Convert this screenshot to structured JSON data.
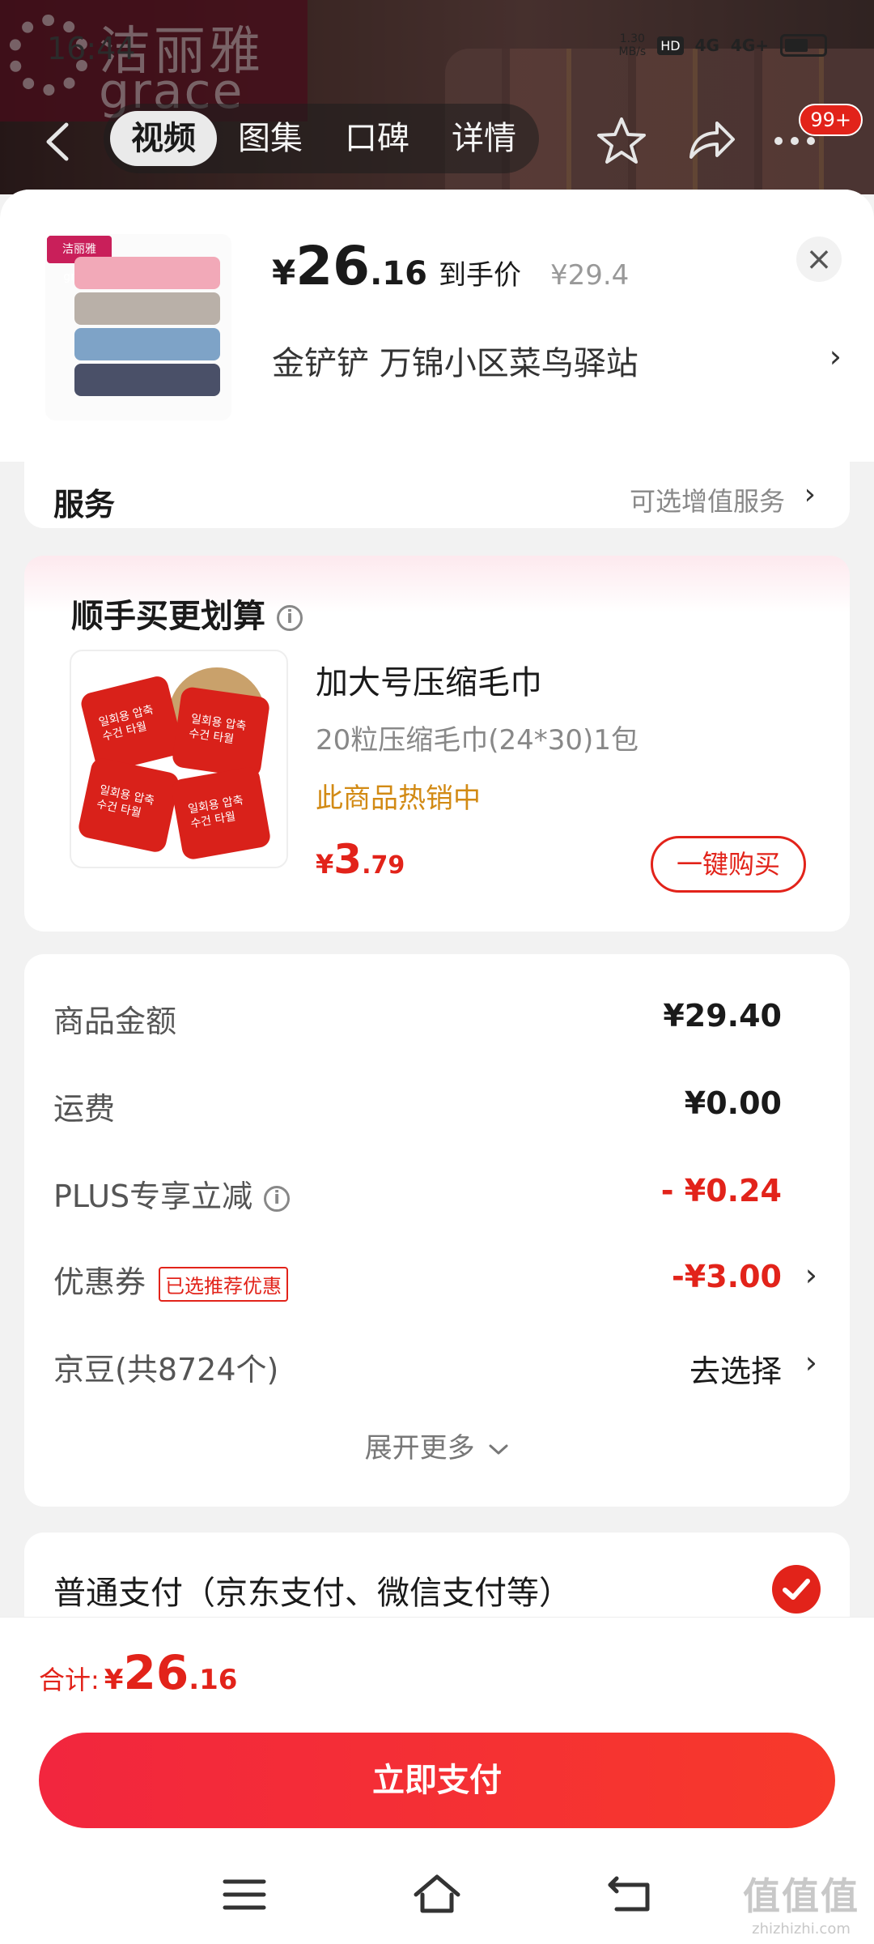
{
  "status_bar": {
    "time": "16:44",
    "net_speed": "1.30\nMB/s",
    "hd": "HD",
    "sim1": "4G",
    "sim2": "4G+"
  },
  "background_page": {
    "brand_cn": "洁丽雅",
    "brand_en": "grace",
    "tabs": [
      {
        "label": "视频",
        "active": true
      },
      {
        "label": "图集",
        "active": false
      },
      {
        "label": "口碑",
        "active": false
      },
      {
        "label": "详情",
        "active": false
      }
    ],
    "cart_badge": "99+"
  },
  "sheet": {
    "product": {
      "thumb_brand": "洁丽雅grace",
      "price_symbol": "¥",
      "price_int": "26",
      "price_dec": ".16",
      "price_label": "到手价",
      "original_price": "¥29.4"
    },
    "close_icon": "close-icon",
    "address": "金铲铲   万锦小区菜鸟驿站",
    "service": {
      "label": "服务",
      "value": "可选增值服务"
    },
    "upsell": {
      "title": "顺手买更划算",
      "name": "加大号压缩毛巾",
      "spec": "20粒压缩毛巾(24*30)1包",
      "hot": "此商品热销中",
      "price_symbol": "¥",
      "price_int": "3",
      "price_dec": ".79",
      "buy_button": "一键购买",
      "pack_text": "일회용 압축\n수건 타월"
    },
    "summary": {
      "rows": [
        {
          "label": "商品金额",
          "value": "¥29.40"
        },
        {
          "label": "运费",
          "value": "¥0.00"
        },
        {
          "label": "PLUS专享立减",
          "value": "- ¥0.24"
        },
        {
          "label": "优惠券",
          "tag": "已选推荐优惠",
          "value": "-¥3.00"
        },
        {
          "label": "京豆(共8724个)",
          "value": "去选择"
        }
      ],
      "expand": "展开更多"
    },
    "payment": {
      "label": "普通支付（京东支付、微信支付等）"
    }
  },
  "footer": {
    "total_label": "合计:",
    "total_symbol": "¥",
    "total_int": "26",
    "total_dec": ".16",
    "pay_button": "立即支付"
  },
  "watermark": {
    "big": "值值值",
    "small": "zhizhizhi.com"
  },
  "colors": {
    "accent": "#e2231a",
    "hot": "#d28a14"
  }
}
